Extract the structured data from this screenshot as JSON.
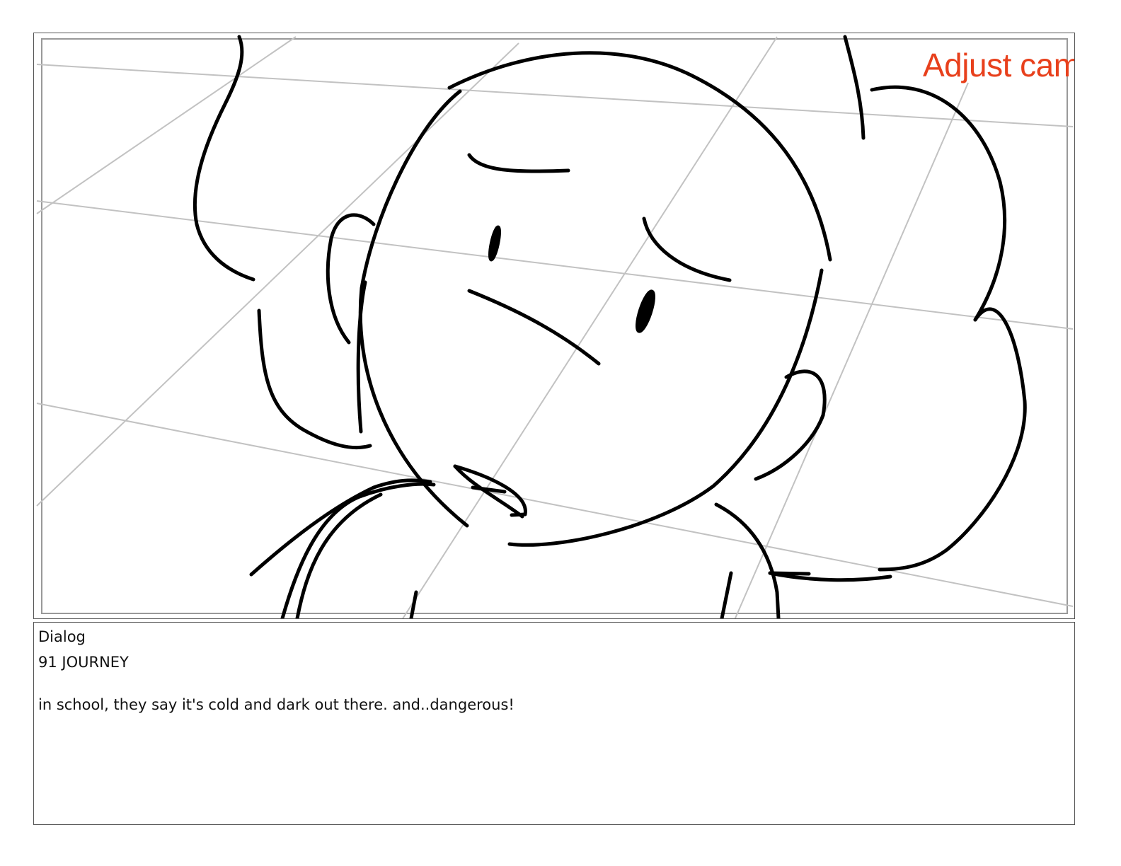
{
  "panel": {
    "camera_note": "Adjust cam",
    "camera_note_color": "#e8401c",
    "sketch": "rough character sketch with perspective grid"
  },
  "dialog": {
    "label": "Dialog",
    "scene": "91 JOURNEY",
    "text": "in school, they say it's cold and dark out there. and..dangerous!"
  }
}
